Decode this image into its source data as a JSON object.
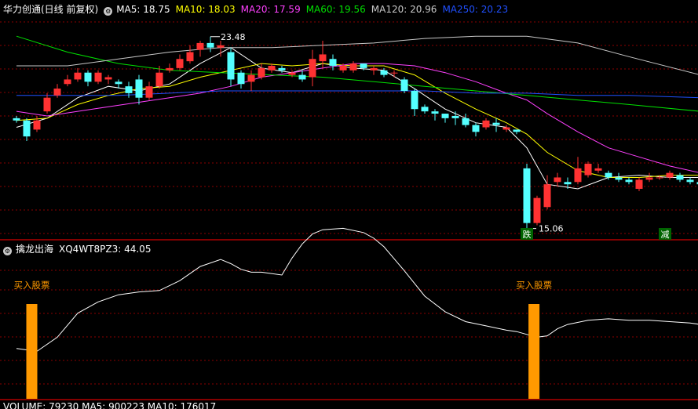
{
  "main_header": {
    "title": "华力创通(日线 前复权)",
    "indicators": [
      {
        "label": "MA5: 18.75",
        "color": "#ffffff"
      },
      {
        "label": "MA10: 18.03",
        "color": "#ffff00"
      },
      {
        "label": "MA20: 17.59",
        "color": "#ff40ff"
      },
      {
        "label": "MA60: 19.56",
        "color": "#00e000"
      },
      {
        "label": "MA120: 20.96",
        "color": "#c8c8c8"
      },
      {
        "label": "MA250: 20.23",
        "color": "#2050ff"
      }
    ]
  },
  "sub_header": {
    "title": "擒龙出海",
    "indicator": "XQ4WT8PZ3: 44.05"
  },
  "bottom_header": {
    "label": "VOLUME: 79230 MA5: 900223 MA10: 176017"
  },
  "annotations": {
    "high_label": "23.48",
    "low_label": "15.06",
    "die_marker": "跌",
    "jian_marker": "减",
    "buy_label_1": "买入股票",
    "buy_label_2": "买入股票"
  },
  "colors": {
    "up": "#ff3232",
    "down": "#54ffff",
    "grid": "#8b0000",
    "buy_bar": "#ff9900"
  },
  "chart_data": {
    "type": "candlestick",
    "price_extremes": {
      "high": 23.48,
      "low": 15.06
    },
    "y_range": [
      14.6,
      24.4
    ],
    "candles": [
      [
        0,
        19.9,
        20.0,
        19.7,
        19.8
      ],
      [
        1,
        19.8,
        19.9,
        18.9,
        19.1
      ],
      [
        2,
        19.4,
        20.0,
        19.3,
        19.8
      ],
      [
        3,
        20.2,
        21.0,
        20.1,
        20.8
      ],
      [
        4,
        20.9,
        21.4,
        20.8,
        21.2
      ],
      [
        5,
        21.4,
        21.8,
        21.3,
        21.6
      ],
      [
        6,
        21.6,
        22.1,
        21.5,
        21.9
      ],
      [
        7,
        21.9,
        22.0,
        21.3,
        21.5
      ],
      [
        8,
        21.5,
        22.0,
        21.4,
        21.9
      ],
      [
        9,
        21.6,
        21.8,
        21.4,
        21.7
      ],
      [
        10,
        21.5,
        21.6,
        21.2,
        21.4
      ],
      [
        11,
        21.3,
        21.5,
        20.8,
        21.0
      ],
      [
        12,
        21.6,
        21.8,
        20.5,
        20.8
      ],
      [
        13,
        20.8,
        21.5,
        20.7,
        21.3
      ],
      [
        14,
        21.3,
        22.2,
        21.2,
        21.9
      ],
      [
        15,
        22.0,
        22.3,
        21.9,
        22.1
      ],
      [
        16,
        22.1,
        22.7,
        22.0,
        22.5
      ],
      [
        17,
        22.4,
        23.1,
        22.3,
        22.8
      ],
      [
        18,
        22.9,
        23.3,
        22.6,
        23.2
      ],
      [
        19,
        23.2,
        23.48,
        22.8,
        23.0
      ],
      [
        20,
        23.0,
        23.3,
        22.6,
        23.1
      ],
      [
        21,
        22.8,
        23.0,
        21.3,
        21.6
      ],
      [
        22,
        21.9,
        22.0,
        21.2,
        21.4
      ],
      [
        23,
        21.5,
        22.0,
        21.1,
        21.8
      ],
      [
        24,
        21.7,
        22.3,
        21.6,
        22.1
      ],
      [
        25,
        22.0,
        22.3,
        21.9,
        22.2
      ],
      [
        26,
        22.1,
        22.2,
        21.9,
        22.0
      ],
      [
        27,
        21.8,
        22.0,
        21.7,
        21.9
      ],
      [
        28,
        21.8,
        22.0,
        21.5,
        21.6
      ],
      [
        29,
        21.7,
        22.9,
        21.3,
        22.5
      ],
      [
        30,
        22.4,
        23.3,
        22.1,
        22.7
      ],
      [
        31,
        22.5,
        22.7,
        22.0,
        22.2
      ],
      [
        32,
        22.0,
        22.3,
        21.9,
        22.2
      ],
      [
        33,
        22.0,
        22.4,
        21.9,
        22.3
      ],
      [
        34,
        22.3,
        22.3,
        22.0,
        22.1
      ],
      [
        35,
        22.0,
        22.2,
        21.8,
        22.1
      ],
      [
        36,
        22.0,
        22.1,
        21.7,
        21.8
      ],
      [
        37,
        21.9,
        22.0,
        21.7,
        21.9
      ],
      [
        38,
        21.6,
        21.7,
        21.0,
        21.1
      ],
      [
        39,
        21.1,
        21.2,
        20.0,
        20.3
      ],
      [
        40,
        20.4,
        20.5,
        20.1,
        20.2
      ],
      [
        41,
        20.2,
        20.3,
        19.8,
        20.1
      ],
      [
        42,
        20.1,
        20.1,
        19.7,
        19.9
      ],
      [
        43,
        20.0,
        20.2,
        19.6,
        19.9
      ],
      [
        44,
        19.9,
        20.1,
        19.5,
        19.6
      ],
      [
        45,
        19.6,
        19.7,
        19.1,
        19.3
      ],
      [
        46,
        19.5,
        19.9,
        19.4,
        19.8
      ],
      [
        47,
        19.7,
        19.9,
        19.3,
        19.6
      ],
      [
        48,
        19.4,
        19.6,
        19.3,
        19.5
      ],
      [
        49,
        19.4,
        19.4,
        19.2,
        19.3
      ],
      [
        50,
        17.7,
        17.9,
        15.06,
        15.3
      ],
      [
        51,
        15.3,
        16.5,
        15.2,
        16.4
      ],
      [
        52,
        16.0,
        17.4,
        15.9,
        17.0
      ],
      [
        53,
        17.1,
        17.5,
        16.9,
        17.3
      ],
      [
        54,
        17.1,
        17.3,
        16.8,
        17.0
      ],
      [
        55,
        17.1,
        18.2,
        17.0,
        17.7
      ],
      [
        56,
        17.4,
        18.0,
        17.3,
        17.9
      ],
      [
        57,
        17.6,
        17.9,
        17.5,
        17.7
      ],
      [
        58,
        17.5,
        17.6,
        17.2,
        17.3
      ],
      [
        59,
        17.3,
        17.5,
        17.1,
        17.2
      ],
      [
        60,
        17.2,
        17.3,
        17.0,
        17.1
      ],
      [
        61,
        16.8,
        17.3,
        16.7,
        17.2
      ],
      [
        62,
        17.2,
        17.5,
        17.1,
        17.3
      ],
      [
        63,
        17.3,
        17.4,
        17.2,
        17.3
      ],
      [
        64,
        17.3,
        17.6,
        17.2,
        17.5
      ],
      [
        65,
        17.4,
        17.5,
        17.1,
        17.2
      ],
      [
        66,
        17.2,
        17.3,
        17.0,
        17.1
      ],
      [
        67,
        17.1,
        17.2,
        16.9,
        17.0
      ]
    ],
    "ma_lines": [
      {
        "name": "MA5",
        "color": "#ffffff",
        "x": [
          0,
          3,
          6,
          9,
          12,
          15,
          18,
          21,
          24,
          27,
          30,
          33,
          36,
          39,
          42,
          45,
          48,
          50,
          52,
          55,
          58,
          61,
          64,
          67
        ],
        "y": [
          19.5,
          19.9,
          20.8,
          21.3,
          21.1,
          21.4,
          22.3,
          23.0,
          22.1,
          21.9,
          22.3,
          22.1,
          22.0,
          21.2,
          20.3,
          19.7,
          19.5,
          18.6,
          17.0,
          16.8,
          17.3,
          17.4,
          17.3,
          17.3
        ]
      },
      {
        "name": "MA10",
        "color": "#ffff00",
        "x": [
          0,
          3,
          6,
          9,
          12,
          15,
          18,
          21,
          24,
          27,
          30,
          33,
          36,
          39,
          42,
          45,
          48,
          50,
          52,
          55,
          58,
          61,
          64,
          67
        ],
        "y": [
          19.8,
          19.9,
          20.5,
          20.9,
          21.2,
          21.3,
          21.7,
          22.0,
          22.3,
          22.2,
          22.3,
          22.2,
          22.2,
          21.8,
          21.0,
          20.3,
          19.7,
          19.2,
          18.4,
          17.6,
          17.3,
          17.3,
          17.4,
          17.4
        ]
      },
      {
        "name": "MA20",
        "color": "#ff40ff",
        "x": [
          0,
          3,
          6,
          9,
          12,
          15,
          18,
          21,
          24,
          27,
          30,
          33,
          36,
          39,
          42,
          45,
          48,
          50,
          52,
          55,
          58,
          61,
          64,
          67
        ],
        "y": [
          20.2,
          20.0,
          20.2,
          20.4,
          20.6,
          20.8,
          21.0,
          21.3,
          21.7,
          21.9,
          22.1,
          22.3,
          22.3,
          22.2,
          21.9,
          21.5,
          21.0,
          20.7,
          20.1,
          19.3,
          18.6,
          18.2,
          17.8,
          17.5
        ]
      },
      {
        "name": "MA60",
        "color": "#00e000",
        "x": [
          0,
          5,
          10,
          15,
          20,
          25,
          30,
          35,
          40,
          45,
          50,
          55,
          60,
          67
        ],
        "y": [
          23.5,
          22.8,
          22.3,
          22.0,
          21.9,
          21.8,
          21.7,
          21.5,
          21.3,
          21.1,
          20.9,
          20.7,
          20.5,
          20.2
        ]
      },
      {
        "name": "MA120",
        "color": "#c8c8c8",
        "x": [
          0,
          5,
          10,
          15,
          20,
          25,
          30,
          35,
          40,
          45,
          50,
          55,
          60,
          67
        ],
        "y": [
          22.2,
          22.2,
          22.5,
          22.8,
          23.0,
          23.0,
          23.1,
          23.2,
          23.4,
          23.5,
          23.5,
          23.2,
          22.6,
          21.8
        ]
      },
      {
        "name": "MA250",
        "color": "#2050ff",
        "x": [
          0,
          5,
          10,
          15,
          20,
          25,
          30,
          35,
          40,
          45,
          50,
          55,
          60,
          67
        ],
        "y": [
          20.9,
          20.9,
          20.9,
          21.0,
          21.1,
          21.1,
          21.1,
          21.1,
          21.1,
          21.0,
          21.0,
          20.9,
          20.9,
          20.8
        ]
      }
    ],
    "oscillator": {
      "name": "XQ4WT8PZ3",
      "color": "#ffffff",
      "y_range": [
        0,
        100
      ],
      "x": [
        0,
        2,
        4,
        6,
        8,
        10,
        12,
        14,
        16,
        18,
        20,
        21,
        22,
        23,
        24,
        26,
        27,
        28,
        29,
        30,
        32,
        34,
        35,
        36,
        38,
        40,
        42,
        44,
        46,
        48,
        49,
        50,
        51,
        52,
        53,
        54,
        56,
        58,
        60,
        62,
        64,
        66,
        67
      ],
      "y": [
        35,
        33,
        43,
        60,
        68,
        73,
        75,
        76,
        83,
        93,
        98,
        95,
        91,
        89,
        89,
        87,
        99,
        109,
        116,
        119,
        120,
        117,
        113,
        107,
        90,
        72,
        61,
        54,
        51,
        48,
        47,
        45,
        43,
        44,
        49,
        52,
        55,
        56,
        55,
        55,
        54,
        53,
        52
      ]
    },
    "buy_signals": [
      {
        "x": 1.5,
        "label": "买入股票"
      },
      {
        "x": 50.7,
        "label": "买入股票"
      }
    ]
  }
}
